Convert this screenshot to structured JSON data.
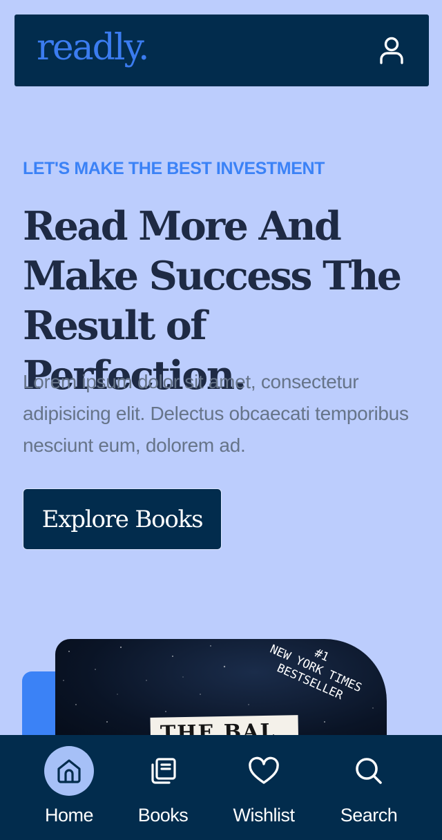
{
  "header": {
    "logo": "readly."
  },
  "hero": {
    "eyebrow": "LET'S MAKE THE BEST INVESTMENT",
    "headline": "Read More And Make Success The Result of Perfection.",
    "lead": "Lorem ipsum dolor sit amet, consectetur adipisicing elit. Delectus obcaecati temporibus nesciunt eum, dolorem ad.",
    "cta_label": "Explore Books"
  },
  "book": {
    "badge_line1": "#1",
    "badge_line2": "NEW YORK TIMES",
    "badge_line3": "BESTSELLER",
    "title_fragment": "THE BAL"
  },
  "nav": {
    "items": [
      {
        "label": "Home",
        "icon": "home-icon",
        "active": true
      },
      {
        "label": "Books",
        "icon": "books-icon",
        "active": false
      },
      {
        "label": "Wishlist",
        "icon": "heart-icon",
        "active": false
      },
      {
        "label": "Search",
        "icon": "search-icon",
        "active": false
      }
    ]
  },
  "colors": {
    "background": "#bccdfd",
    "navy": "#022c4d",
    "accent": "#3b82f6",
    "active_nav": "#a6c0f7"
  }
}
